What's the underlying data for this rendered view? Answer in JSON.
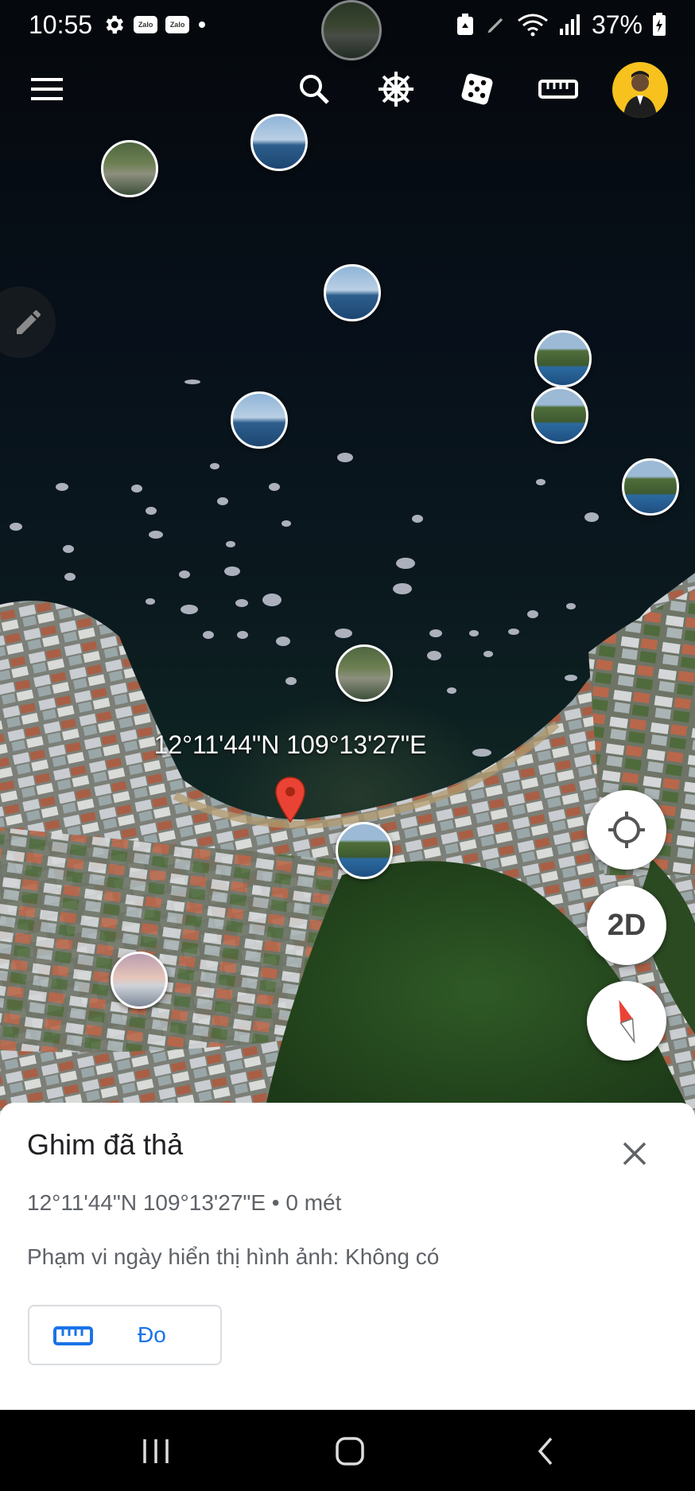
{
  "status_bar": {
    "time": "10:55",
    "notification_icons": [
      "gear-icon",
      "zalo-icon",
      "zalo-icon",
      "dot-icon"
    ],
    "zalo_label": "Zalo",
    "battery_percent": "37%"
  },
  "toolbar": {
    "menu_icon": "hamburger-menu-icon",
    "search_icon": "search-icon",
    "voyager_icon": "ship-wheel-icon",
    "feeling_lucky_icon": "dice-icon",
    "measure_icon": "ruler-icon",
    "avatar": "user-avatar"
  },
  "map": {
    "coordinate_label": "12°11'44\"N 109°13'27\"E",
    "pin_color": "#ea4335"
  },
  "floating_buttons": {
    "locate_icon": "my-location-icon",
    "view_mode_label": "2D",
    "compass_icon": "compass-icon"
  },
  "sheet": {
    "title": "Ghim đã thả",
    "coordinates": "12°11'44\"N 109°13'27\"E • 0 mét",
    "image_date_range": "Phạm vi ngày hiển thị hình ảnh: Không có",
    "measure_button_label": "Đo",
    "accent_color": "#1a73e8"
  },
  "nav_bar": {
    "recents_icon": "recents-icon",
    "home_icon": "home-icon",
    "back_icon": "back-icon"
  }
}
